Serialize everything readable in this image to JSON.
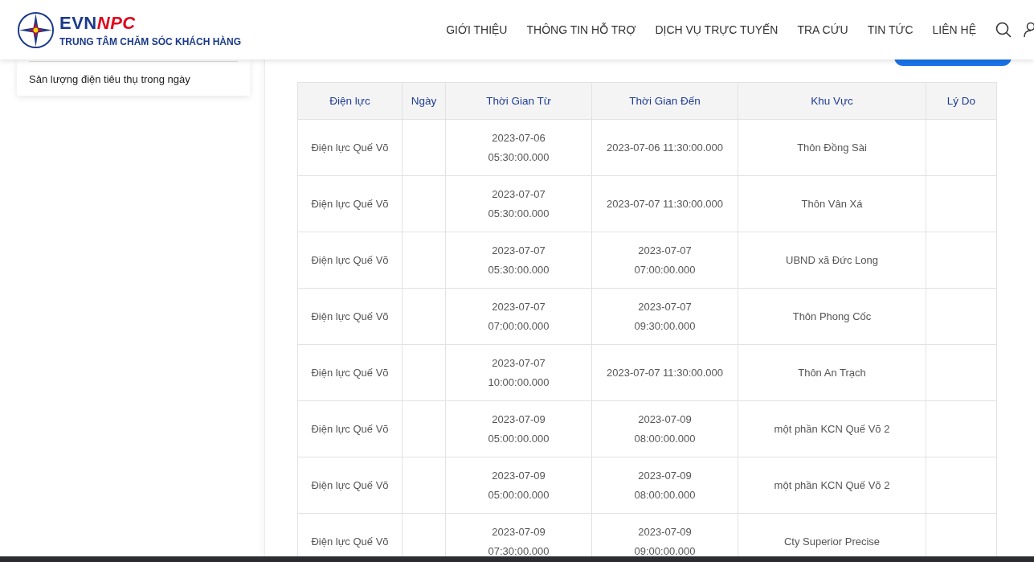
{
  "header": {
    "logo": {
      "brand_main": "EVN",
      "brand_accent": "NPC",
      "tagline": "TRUNG TÂM CHĂM SÓC KHÁCH HÀNG"
    },
    "nav": [
      "GIỚI THIỆU",
      "THÔNG TIN HỖ TRỢ",
      "DỊCH VỤ TRỰC TUYẾN",
      "TRA CỨU",
      "TIN TỨC",
      "LIÊN HỆ"
    ]
  },
  "sidebar": {
    "items": [
      "Sản lượng điện tiêu thụ trong ngày"
    ]
  },
  "table": {
    "columns": [
      "Điện lực",
      "Ngày",
      "Thời Gian Từ",
      "Thời Gian Đến",
      "Khu Vực",
      "Lý Do"
    ],
    "rows": [
      [
        "Điện lực Quế Võ",
        "",
        "2023-07-06\n05:30:00.000",
        "2023-07-06 11:30:00.000",
        "Thôn Đồng Sài",
        ""
      ],
      [
        "Điện lực Quế Võ",
        "",
        "2023-07-07\n05:30:00.000",
        "2023-07-07 11:30:00.000",
        "Thôn Vân Xá",
        ""
      ],
      [
        "Điện lực Quế Võ",
        "",
        "2023-07-07\n05:30:00.000",
        "2023-07-07\n07:00:00.000",
        "UBND xã Đức Long",
        ""
      ],
      [
        "Điện lực Quế Võ",
        "",
        "2023-07-07\n07:00:00.000",
        "2023-07-07\n09:30:00.000",
        "Thôn Phong Cốc",
        ""
      ],
      [
        "Điện lực Quế Võ",
        "",
        "2023-07-07\n10:00:00.000",
        "2023-07-07 11:30:00.000",
        "Thôn An Trạch",
        ""
      ],
      [
        "Điện lực Quế Võ",
        "",
        "2023-07-09\n05:00:00.000",
        "2023-07-09\n08:00:00.000",
        "một phần KCN Quế Võ 2",
        ""
      ],
      [
        "Điện lực Quế Võ",
        "",
        "2023-07-09\n05:00:00.000",
        "2023-07-09\n08:00:00.000",
        "một phần KCN Quế Võ 2",
        ""
      ],
      [
        "Điện lực Quế Võ",
        "",
        "2023-07-09\n07:30:00.000",
        "2023-07-09\n09:00:00.000",
        "Cty Superior Precise",
        ""
      ]
    ]
  }
}
